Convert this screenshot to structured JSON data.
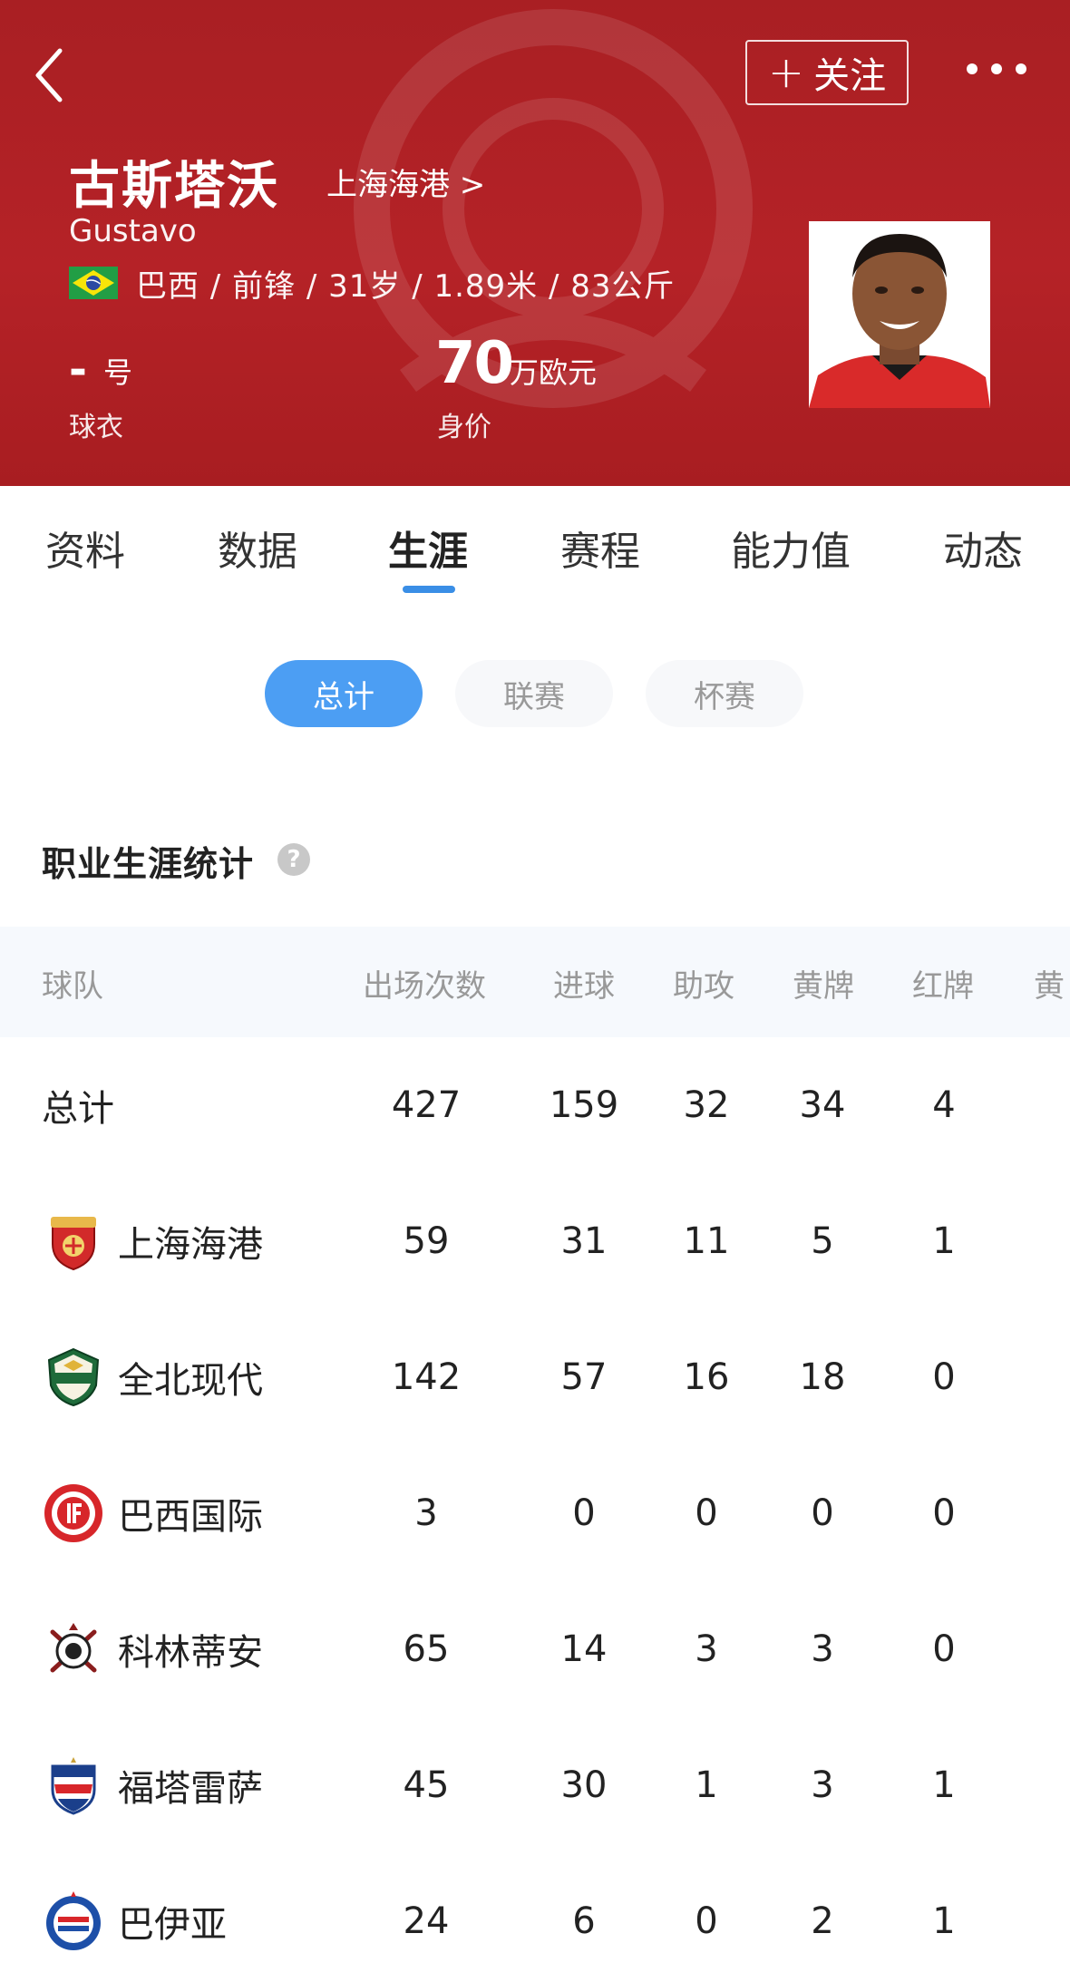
{
  "header": {
    "follow_label": "关注",
    "name_cn": "古斯塔沃",
    "team_link": "上海海港 >",
    "name_en": "Gustavo",
    "bio": "巴西 / 前锋 / 31岁 / 1.89米 / 83公斤",
    "jersey_number": "-",
    "jersey_unit": "号",
    "jersey_label": "球衣",
    "market_value": "70",
    "market_value_unit": "万欧元",
    "market_value_label": "身价",
    "accent_color": "#b52227"
  },
  "tabs": [
    {
      "label": "资料"
    },
    {
      "label": "数据"
    },
    {
      "label": "生涯",
      "active": true
    },
    {
      "label": "赛程"
    },
    {
      "label": "能力值"
    },
    {
      "label": "动态"
    }
  ],
  "segments": [
    {
      "label": "总计",
      "active": true
    },
    {
      "label": "联赛"
    },
    {
      "label": "杯赛"
    }
  ],
  "section": {
    "title": "职业生涯统计",
    "help_glyph": "?"
  },
  "table": {
    "headers": [
      "球队",
      "出场次数",
      "进球",
      "助攻",
      "黄牌",
      "红牌",
      "黄"
    ],
    "rows": [
      {
        "team": "总计",
        "apps": "427",
        "goals": "159",
        "assists": "32",
        "yellow": "34",
        "red": "4"
      },
      {
        "team": "上海海港",
        "logo": "shanghai-port-logo",
        "apps": "59",
        "goals": "31",
        "assists": "11",
        "yellow": "5",
        "red": "1"
      },
      {
        "team": "全北现代",
        "logo": "jeonbuk-logo",
        "apps": "142",
        "goals": "57",
        "assists": "16",
        "yellow": "18",
        "red": "0"
      },
      {
        "team": "巴西国际",
        "logo": "internacional-logo",
        "apps": "3",
        "goals": "0",
        "assists": "0",
        "yellow": "0",
        "red": "0"
      },
      {
        "team": "科林蒂安",
        "logo": "corinthians-logo",
        "apps": "65",
        "goals": "14",
        "assists": "3",
        "yellow": "3",
        "red": "0"
      },
      {
        "team": "福塔雷萨",
        "logo": "fortaleza-logo",
        "apps": "45",
        "goals": "30",
        "assists": "1",
        "yellow": "3",
        "red": "1"
      },
      {
        "team": "巴伊亚",
        "logo": "bahia-logo",
        "apps": "24",
        "goals": "6",
        "assists": "0",
        "yellow": "2",
        "red": "1"
      }
    ]
  },
  "colors": {
    "tab_indicator": "#3a8ee6",
    "segment_active": "#4c9ef3"
  }
}
